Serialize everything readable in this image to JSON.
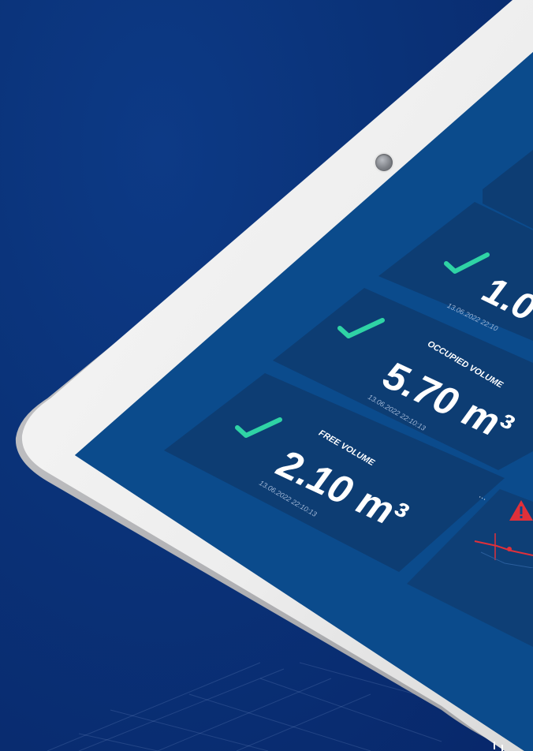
{
  "dashboard": {
    "tiles": [
      {
        "id": "top-partial",
        "label": "",
        "value": "",
        "timestamp": "",
        "status": "ok"
      },
      {
        "id": "level-tile",
        "label": "",
        "value": "1.0",
        "timestamp": "13.06.2022 22:10",
        "status": "ok"
      },
      {
        "id": "occupied-volume",
        "label": "OCCUPIED VOLUME",
        "value": "5.70 m³",
        "timestamp": "13.06.2022 22:10:13",
        "status": "ok"
      },
      {
        "id": "free-volume",
        "label": "FREE VOLUME",
        "value": "2.10 m³",
        "timestamp": "13.06.2022 22:10:13",
        "status": "ok",
        "menu": "..."
      }
    ],
    "warning_tile": {
      "status": "warning"
    }
  },
  "colors": {
    "background": "#0a3278",
    "screen": "#0a4a8a",
    "tile": "#0d3d73",
    "check": "#2fd3a5",
    "warning": "#e0303a",
    "bezel": "#f1f1f1"
  },
  "icons": [
    "camera-lens-icon",
    "check-icon",
    "warning-triangle-icon",
    "more-dots-icon"
  ]
}
